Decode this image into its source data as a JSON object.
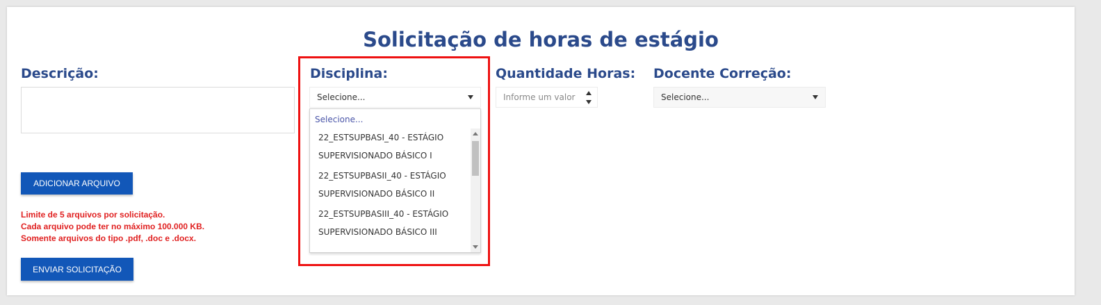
{
  "page": {
    "title": "Solicitação de horas de estágio"
  },
  "form": {
    "descricao_label": "Descrição:",
    "disciplina_label": "Disciplina:",
    "quantidade_label": "Quantidade Horas:",
    "docente_label": "Docente Correção:",
    "disciplina_select_value": "Selecione...",
    "quantidade_placeholder": "Informe um valor",
    "docente_select_value": "Selecione..."
  },
  "actions": {
    "add_file_label": "ADICIONAR ARQUIVO",
    "send_label": "ENVIAR SOLICITAÇÃO"
  },
  "warnings": [
    "Limite de 5 arquivos por solicitação.",
    "Cada arquivo pode ter no máximo 100.000 KB.",
    "Somente arquivos do tipo .pdf, .doc e .docx."
  ],
  "dropdown": {
    "placeholder": "Selecione...",
    "options": [
      {
        "line1": "22_ESTSUPBASI_40 - ESTÁGIO",
        "line2": "SUPERVISIONADO BÁSICO I"
      },
      {
        "line1": "22_ESTSUPBASII_40 - ESTÁGIO",
        "line2": "SUPERVISIONADO BÁSICO II"
      },
      {
        "line1": "22_ESTSUPBASIII_40 - ESTÁGIO",
        "line2": "SUPERVISIONADO BÁSICO III"
      }
    ]
  },
  "colors": {
    "heading": "#2b4a8b",
    "button": "#1257b8",
    "warning": "#e02020",
    "highlight": "#ee1111"
  }
}
